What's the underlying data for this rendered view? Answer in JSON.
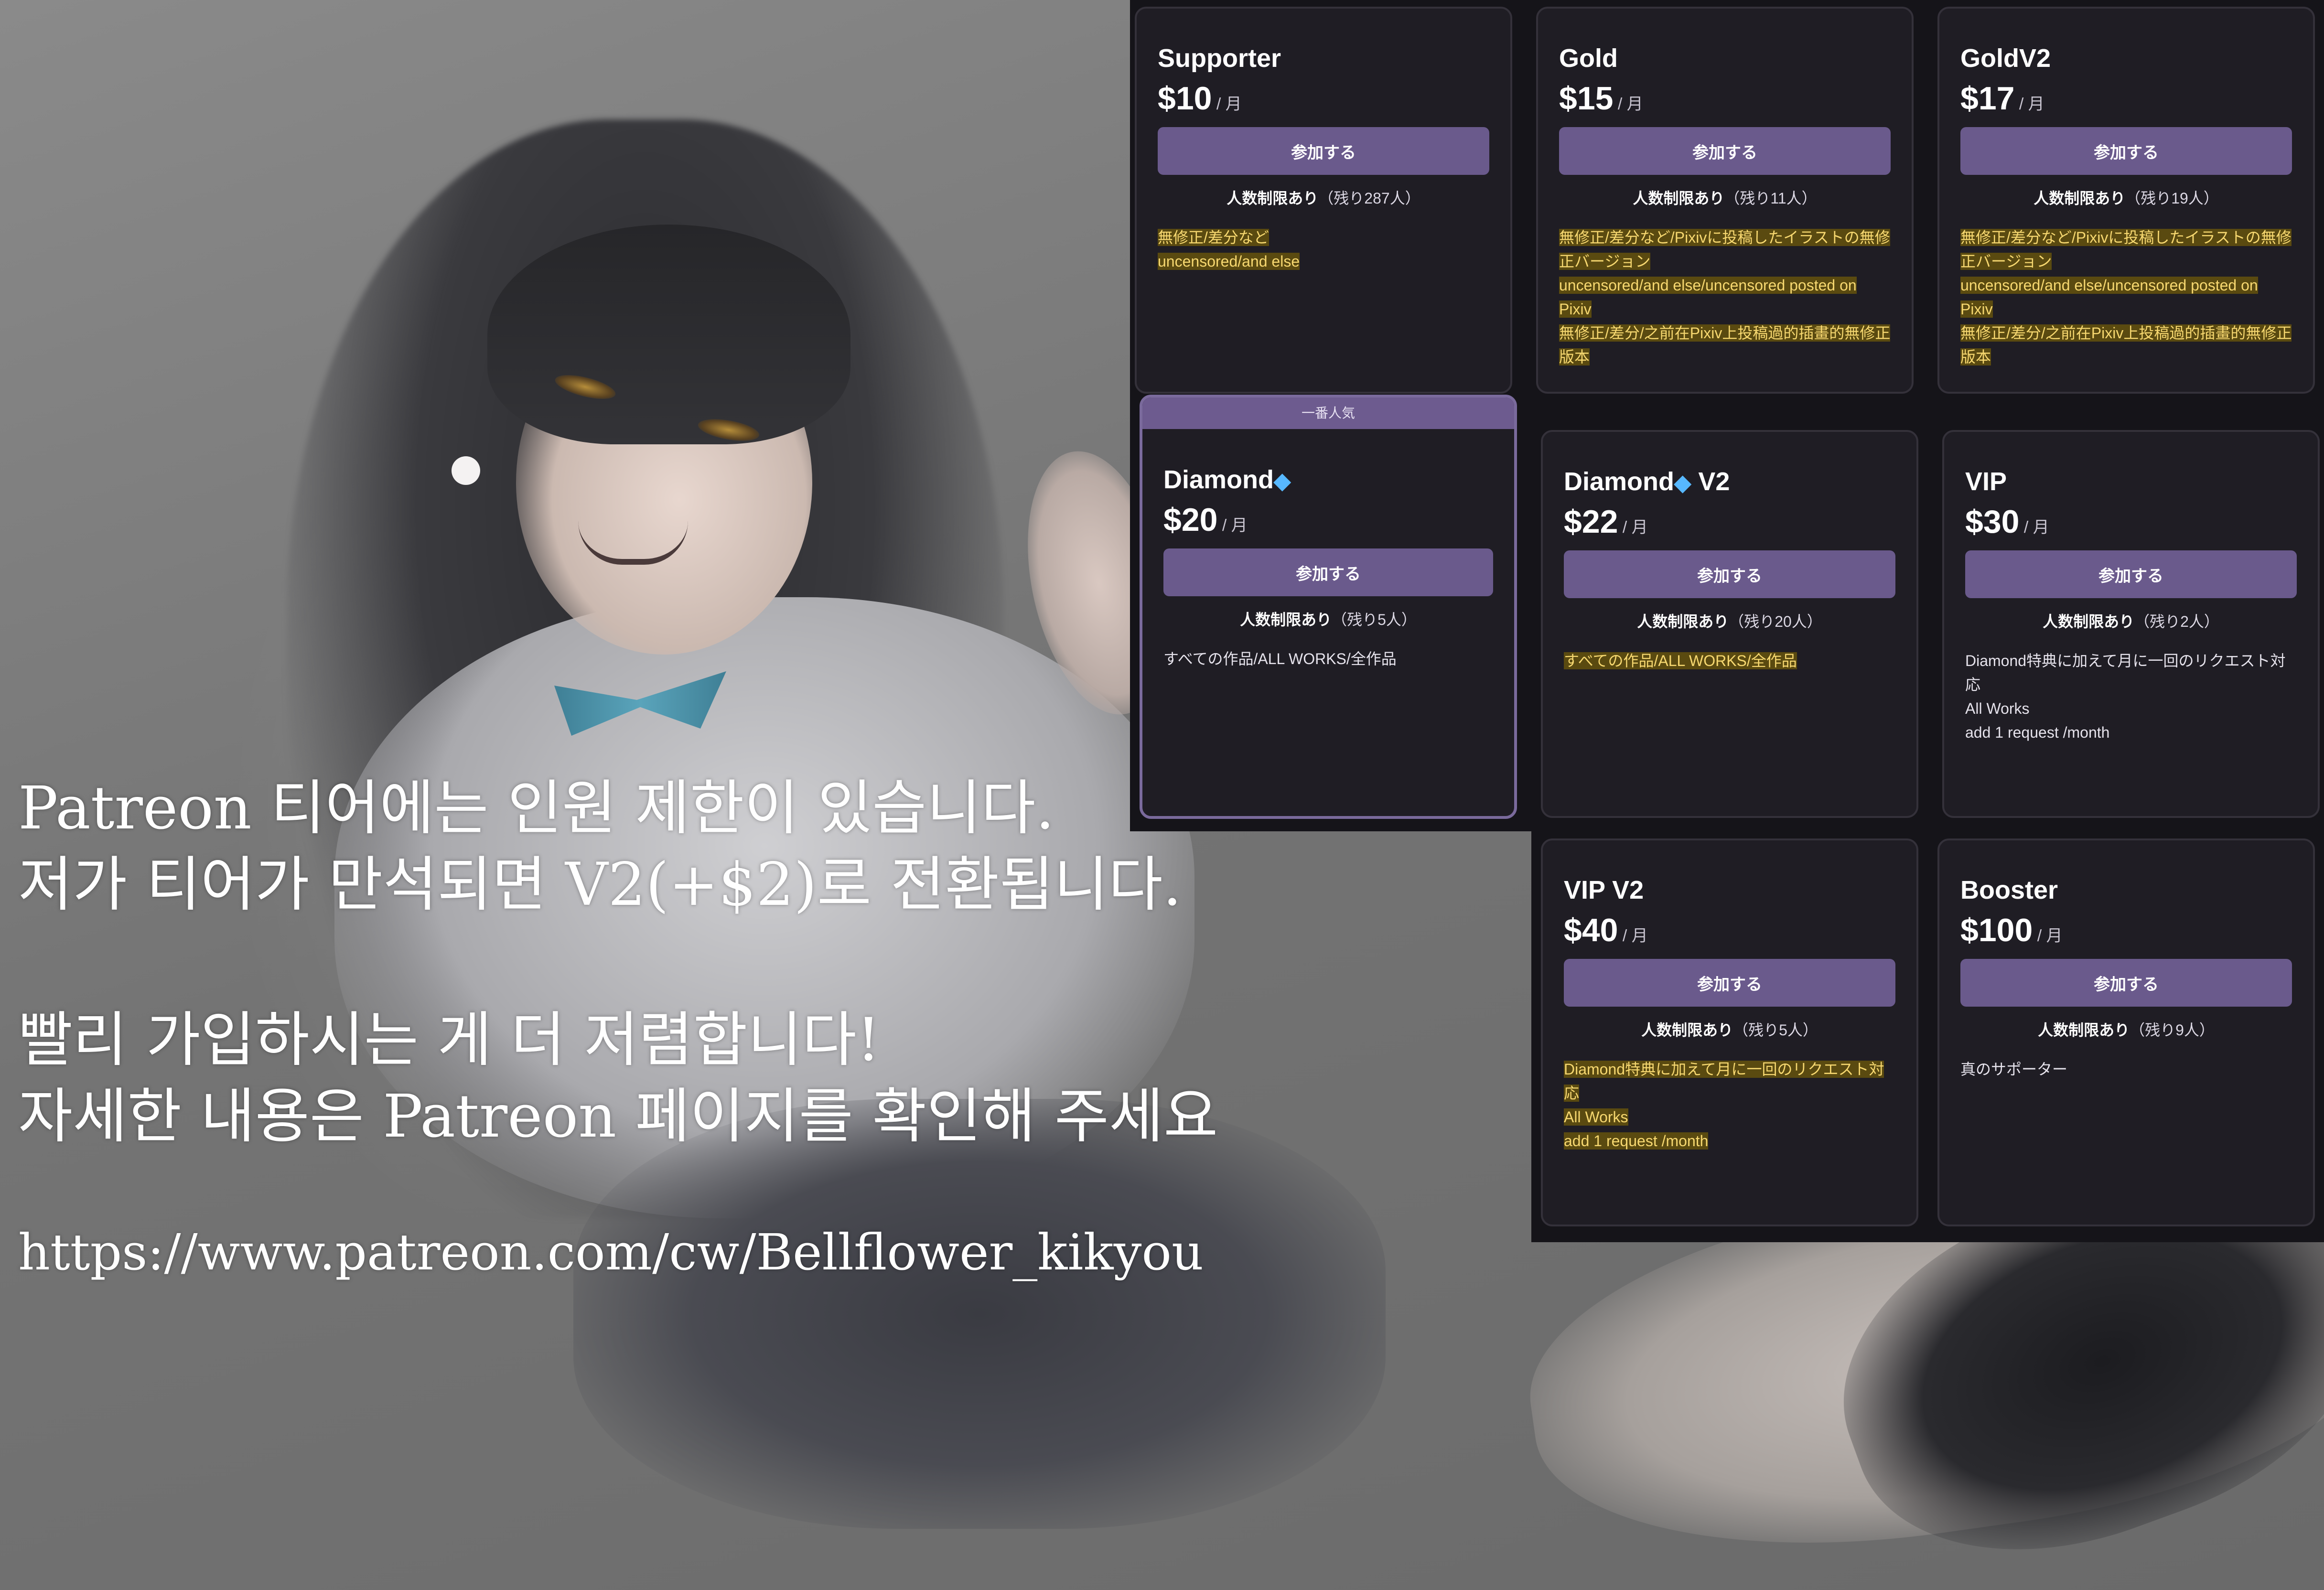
{
  "overlay": {
    "line1": "Patreon 티어에는 인원 제한이 있습니다.",
    "line2": "저가 티어가 만석되면 V2(+$2)로 전환됩니다.",
    "line3": "빨리 가입하시는 게 더 저렴합니다!",
    "line4": "자세한 내용은 Patreon 페이지를 확인해 주세요",
    "url": "https://www.patreon.com/cw/Bellflower_kikyou"
  },
  "common": {
    "per_month": "/ 月",
    "join_label": "参加する",
    "limit_label": "人数制限あり"
  },
  "tiers": [
    {
      "name": "Supporter",
      "price": "$10",
      "remaining": "（残り287人）",
      "desc": [
        "無修正/差分など",
        "uncensored/and else"
      ],
      "highlighted": true
    },
    {
      "name": "Gold",
      "price": "$15",
      "remaining": "（残り11人）",
      "desc": [
        "無修正/差分など/Pixivに投稿したイラストの無修正バージョン",
        "uncensored/and else/uncensored posted on Pixiv",
        "無修正/差分/之前在Pixiv上投稿過的插畫的無修正版本"
      ],
      "highlighted": true
    },
    {
      "name": "GoldV2",
      "price": "$17",
      "remaining": "（残り19人）",
      "desc": [
        "無修正/差分など/Pixivに投稿したイラストの無修正バージョン",
        "uncensored/and else/uncensored posted on Pixiv",
        "無修正/差分/之前在Pixiv上投稿過的插畫的無修正版本"
      ],
      "highlighted": true
    },
    {
      "name": "Diamond",
      "price": "$20",
      "remaining": "（残り5人）",
      "badge": "一番人気",
      "desc": [
        "すべての作品/ALL WORKS/全作品"
      ],
      "highlighted": false,
      "icon": "diamond-icon"
    },
    {
      "name": "Diamond",
      "name_suffix": "V2",
      "price": "$22",
      "remaining": "（残り20人）",
      "desc": [
        "すべての作品/ALL WORKS/全作品"
      ],
      "highlighted": true,
      "icon": "diamond-icon"
    },
    {
      "name": "VIP",
      "price": "$30",
      "remaining": "（残り2人）",
      "desc": [
        "Diamond特典に加えて月に一回のリクエスト対応",
        "All Works",
        "add 1 request /month"
      ],
      "highlighted": false
    },
    {
      "name": "VIP V2",
      "price": "$40",
      "remaining": "（残り5人）",
      "desc": [
        "Diamond特典に加えて月に一回のリクエスト対応",
        "All Works",
        "add 1 request /month"
      ],
      "highlighted": true
    },
    {
      "name": "Booster",
      "price": "$100",
      "remaining": "（残り9人）",
      "desc": [
        "真のサポーター"
      ],
      "highlighted": false
    }
  ],
  "colors": {
    "card_bg": "#1f1d24",
    "button": "#6a5a8c",
    "highlight_bg": "#5a4a10",
    "highlight_text": "#f7d870",
    "gem": "#57b8ff"
  }
}
